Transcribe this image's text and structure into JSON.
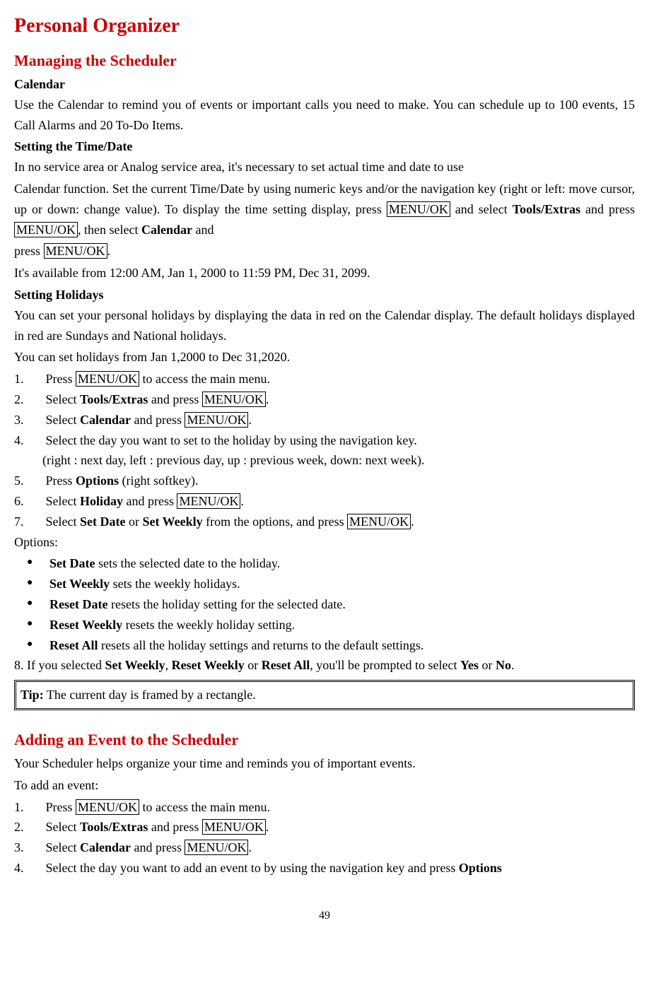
{
  "title": "Personal Organizer",
  "section1": {
    "heading": "Managing the Scheduler",
    "calendar_heading": "Calendar",
    "calendar_para": "Use the Calendar to remind you of events or important calls you need to make. You can schedule up to 100 events, 15 Call Alarms and 20 To-Do Items.",
    "time_heading": "Setting the Time/Date",
    "time_p1a": "In no service area or Analog service area, it's necessary to set actual time and date to use",
    "time_p1b": "Calendar function. Set the current Time/Date by using numeric keys and/or the navigation key (right or left: move cursor, up or down: change value). To display the time setting display, press ",
    "menuok": "MENU/OK",
    "time_p1c": " and select ",
    "toolsextras": "Tools/Extras",
    "time_p1d": " and press ",
    "time_p1e": ", then select ",
    "calendar": "Calendar",
    "time_p1f": " and",
    "time_p2a": "press ",
    "time_p2b": ".",
    "time_p3": "It's available from 12:00 AM, Jan 1, 2000 to 11:59 PM, Dec 31, 2099.",
    "holidays_heading": "Setting Holidays",
    "holidays_para": "You can set your personal holidays by displaying the data in red on the Calendar display. The default holidays displayed in red are Sundays and National holidays.",
    "holidays_range": "You can set holidays from Jan 1,2000 to Dec 31,2020.",
    "step1a": "Press ",
    "step1b": " to access the main menu.",
    "step2a": "Select ",
    "step2b": " and press ",
    "step2c": ".",
    "step3a": "Select ",
    "step3b": " and press ",
    "step3c": ".",
    "step4": "Select the day you want to set to the holiday by using the navigation key.",
    "step4_sub": "(right : next day, left : previous day, up : previous week, down: next week).",
    "step5a": "Press ",
    "options": "Options",
    "step5b": " (right softkey).",
    "step6a": "Select ",
    "holiday": "Holiday",
    "step6b": " and press ",
    "step6c": ".",
    "step7a": "Select ",
    "setdate": "Set Date",
    "step7b": " or ",
    "setweekly": "Set Weekly",
    "step7c": " from the options, and press ",
    "step7d": ".",
    "options_label": "Options:",
    "opt1a": "Set Date",
    "opt1b": " sets the selected date to the holiday.",
    "opt2a": "Set Weekly",
    "opt2b": " sets the weekly holidays.",
    "opt3a": "Reset Date",
    "opt3b": " resets the holiday setting for the selected date.",
    "opt4a": "Reset Weekly",
    "opt4b": " resets the weekly holiday setting.",
    "opt5a": "Reset All",
    "opt5b": " resets all the holiday settings and returns to the default settings.",
    "step8a": "8. If you selected ",
    "step8b": ", ",
    "resetweekly": "Reset Weekly",
    "step8c": " or ",
    "resetall": "Reset All",
    "step8d": ", you'll be prompted to select ",
    "yes": "Yes",
    "step8e": " or ",
    "no": "No",
    "step8f": ".",
    "tip_label": "Tip:",
    "tip_text": " The current day is framed by a rectangle."
  },
  "section2": {
    "heading": "Adding an Event to the Scheduler",
    "intro": "Your Scheduler helps organize your time and reminds you of important events.",
    "to_add": "To add an event:",
    "step1a": "Press ",
    "step1b": " to access the main menu.",
    "step2a": "Select ",
    "step2b": " and press ",
    "step2c": ".",
    "step3a": "Select ",
    "step3b": " and press ",
    "step3c": ".",
    "step4a": "Select the day you want to add an event to by using the navigation key and press ",
    "options": "Options"
  },
  "page_number": "49"
}
